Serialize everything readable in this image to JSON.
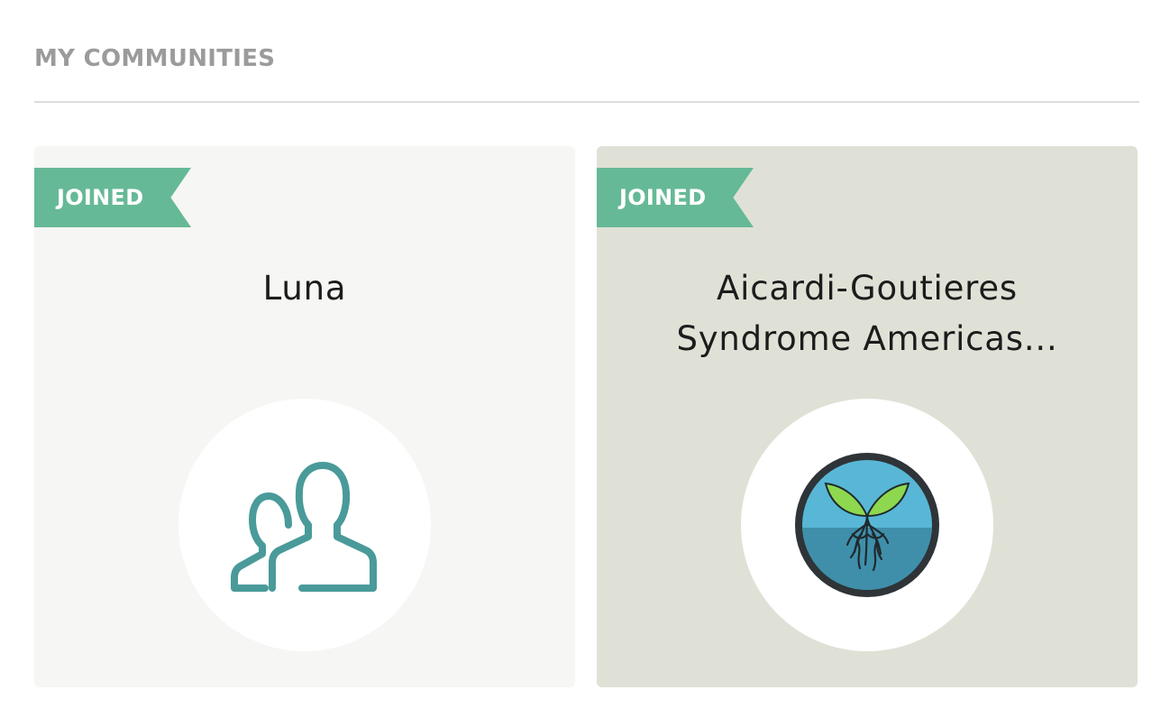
{
  "section": {
    "title": "MY COMMUNITIES"
  },
  "colors": {
    "ribbon": "#66b996",
    "people_icon": "#4a9a9a",
    "card_light": "#f6f6f4",
    "card_sage": "#e0e1d6"
  },
  "communities": [
    {
      "badge": "JOINED",
      "name": "Luna",
      "icon": "people-icon"
    },
    {
      "badge": "JOINED",
      "name": "Aicardi-Goutieres Syndrome Americas...",
      "icon": "sprout-logo-icon"
    }
  ]
}
